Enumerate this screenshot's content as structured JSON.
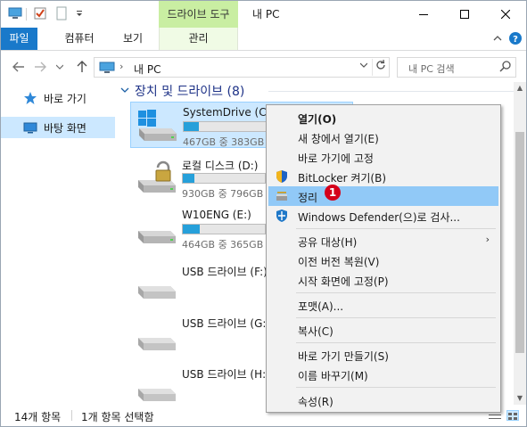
{
  "window": {
    "title": "내 PC",
    "context_tab_group": "드라이브 도구"
  },
  "ribbon": {
    "tabs": [
      {
        "label": "파일"
      },
      {
        "label": "컴퓨터"
      },
      {
        "label": "보기"
      },
      {
        "label": "관리"
      }
    ]
  },
  "address": {
    "crumb": "내 PC",
    "search_placeholder": "내 PC 검색"
  },
  "nav": {
    "items": [
      {
        "label": "바로 가기",
        "icon": "star-icon"
      },
      {
        "label": "바탕 화면",
        "icon": "desktop-icon"
      }
    ]
  },
  "content": {
    "group_label": "장치 및 드라이브 (8)",
    "drives": [
      {
        "name": "SystemDrive (C:)",
        "size": "467GB 중 383GB",
        "used_fraction": 0.18,
        "icon": "windows-drive-icon"
      },
      {
        "name": "로컬 디스크 (D:)",
        "size": "930GB 중 796GB",
        "used_fraction": 0.14,
        "icon": "locked-drive-icon"
      },
      {
        "name": "W10ENG (E:)",
        "size": "464GB 중 365GB",
        "used_fraction": 0.21,
        "icon": "hard-drive-icon"
      },
      {
        "name": "USB 드라이브 (F:)",
        "icon": "usb-drive-icon"
      },
      {
        "name": "USB 드라이브 (G:)",
        "icon": "usb-drive-icon"
      },
      {
        "name": "USB 드라이브 (H:)",
        "icon": "usb-drive-icon"
      }
    ]
  },
  "context_menu": {
    "items": [
      {
        "label": "열기(O)",
        "bold": true
      },
      {
        "label": "새 창에서 열기(E)"
      },
      {
        "label": "바로 가기에 고정"
      },
      {
        "label": "BitLocker 켜기(B)",
        "icon": "shield-icon"
      },
      {
        "label": "정리",
        "icon": "cleanup-icon",
        "highlighted": true
      },
      {
        "label": "Windows Defender(으)로 검사...",
        "icon": "defender-icon"
      },
      {
        "label": "공유 대상(H)",
        "submenu": true
      },
      {
        "label": "이전 버전 복원(V)"
      },
      {
        "label": "시작 화면에 고정(P)"
      },
      {
        "label": "포맷(A)..."
      },
      {
        "label": "복사(C)"
      },
      {
        "label": "바로 가기 만들기(S)"
      },
      {
        "label": "이름 바꾸기(M)"
      },
      {
        "label": "속성(R)"
      }
    ],
    "badge": "1"
  },
  "status": {
    "item_count": "14개 항목",
    "selected": "1개 항목 선택함"
  },
  "colors": {
    "accent": "#1979ca",
    "context_tab": "#c9eea2",
    "selection": "#cce8ff",
    "menu_highlight": "#91c9f7",
    "badge": "#d5001a",
    "usage_bar": "#26a0da"
  }
}
